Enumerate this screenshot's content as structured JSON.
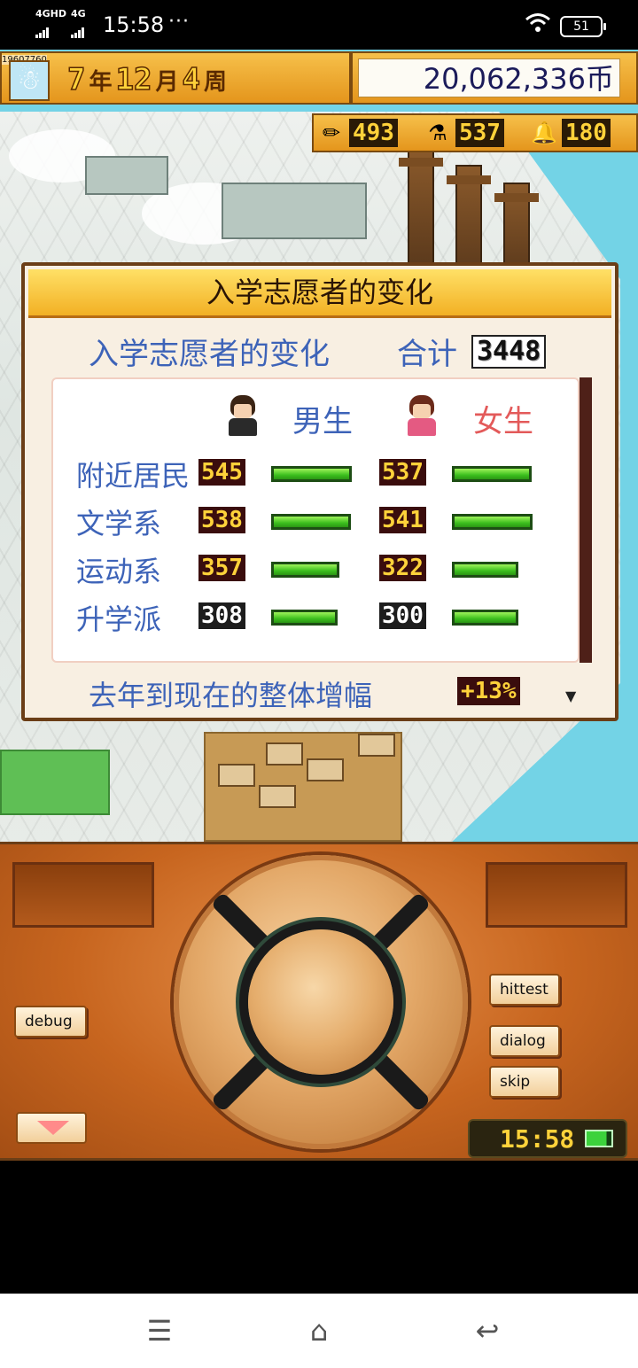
{
  "status_bar": {
    "signal1": "4GHD",
    "signal2": "4G",
    "time": "15:58",
    "more": "···",
    "battery": "51"
  },
  "hud": {
    "id_text": "19607760",
    "year": "7",
    "year_unit": "年",
    "month": "12",
    "month_unit": "月",
    "week": "4",
    "week_unit": "周",
    "money": "20,062,336币",
    "resources": [
      {
        "icon": "pencil-icon",
        "value": "493"
      },
      {
        "icon": "flask-icon",
        "value": "537"
      },
      {
        "icon": "bell-icon",
        "value": "180"
      }
    ]
  },
  "modal": {
    "title": "入学志愿者的变化",
    "subtitle": "入学志愿者的变化",
    "total_label": "合计",
    "total_value": "3448",
    "male_label": "男生",
    "female_label": "女生",
    "rows": [
      {
        "label": "附近居民",
        "male": "545",
        "female": "537",
        "male_level": 0.95,
        "female_level": 0.94
      },
      {
        "label": "文学系",
        "male": "538",
        "female": "541",
        "male_level": 0.94,
        "female_level": 0.95
      },
      {
        "label": "运动系",
        "male": "357",
        "female": "322",
        "male_level": 0.8,
        "female_level": 0.78
      },
      {
        "label": "升学派",
        "male": "308",
        "female": "300",
        "male_level": 0.78,
        "female_level": 0.78
      }
    ],
    "footer_label": "去年到现在的整体增幅",
    "growth_value": "+13%",
    "more_arrow": "▼"
  },
  "controller": {
    "debug_label": "debug",
    "hittest_label": "hittest",
    "dialog_label": "dialog",
    "skip_label": "skip",
    "clock": "15:58"
  },
  "navbar": {
    "menu": "☰",
    "home": "⌂",
    "back": "↩"
  },
  "colors": {
    "accent_orange": "#e4951c",
    "label_blue": "#3d63b8",
    "female_red": "#e35a5a",
    "bar_green": "#3cbf1e"
  }
}
